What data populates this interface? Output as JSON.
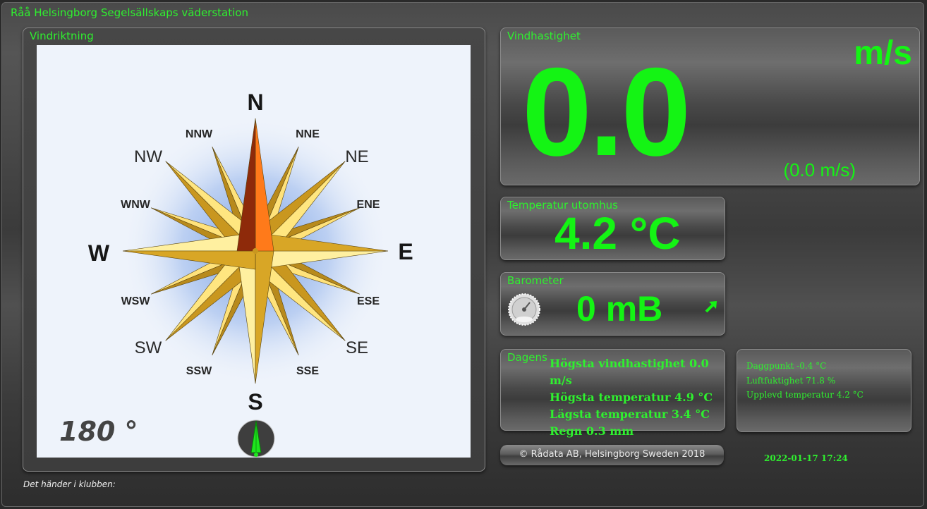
{
  "app": {
    "title": "Råå Helsingborg Segelsällskaps väderstation"
  },
  "wind_direction": {
    "label": "Vindriktning",
    "degrees_text": "180 °",
    "labels": {
      "n": "N",
      "nne": "NNE",
      "ne": "NE",
      "ene": "ENE",
      "e": "E",
      "ese": "ESE",
      "se": "SE",
      "sse": "SSE",
      "s": "S",
      "ssw": "SSW",
      "sw": "SW",
      "wsw": "WSW",
      "w": "W",
      "wnw": "WNW",
      "nw": "NW",
      "nnw": "NNW"
    },
    "pointer_icon": "wind-pointer-icon"
  },
  "wind_speed": {
    "label": "Vindhastighet",
    "value": "0.0",
    "unit": "m/s",
    "secondary": "(0.0 m/s)"
  },
  "temperature": {
    "label": "Temperatur utomhus",
    "value": "4.2 °C"
  },
  "barometer": {
    "label": "Barometer",
    "value": "0 mB",
    "icon": "gauge-icon",
    "trend_icon": "arrow-up-right-icon"
  },
  "daily": {
    "label": "Dagens",
    "max_wind": "Högsta vindhastighet 0.0 m/s",
    "max_temp": "Högsta temperatur 4.9 °C",
    "min_temp": "Lägsta temperatur 3.4 °C",
    "rain": "Regn 0.3 mm"
  },
  "extra": {
    "dewpoint": "Daggpunkt -0.4 °C",
    "humidity": "Luftfuktighet 71.8 %",
    "feels_like": "Upplevd temperatur 4.2 °C"
  },
  "footer": {
    "copyright": "© Rådata AB, Helsingborg Sweden 2018",
    "datetime": "2022-01-17 17:24",
    "club_news": "Det händer i klubben:"
  },
  "colors": {
    "accent": "#14f414",
    "label_green": "#2ff02f",
    "compass_bg": "#eef3fb"
  }
}
